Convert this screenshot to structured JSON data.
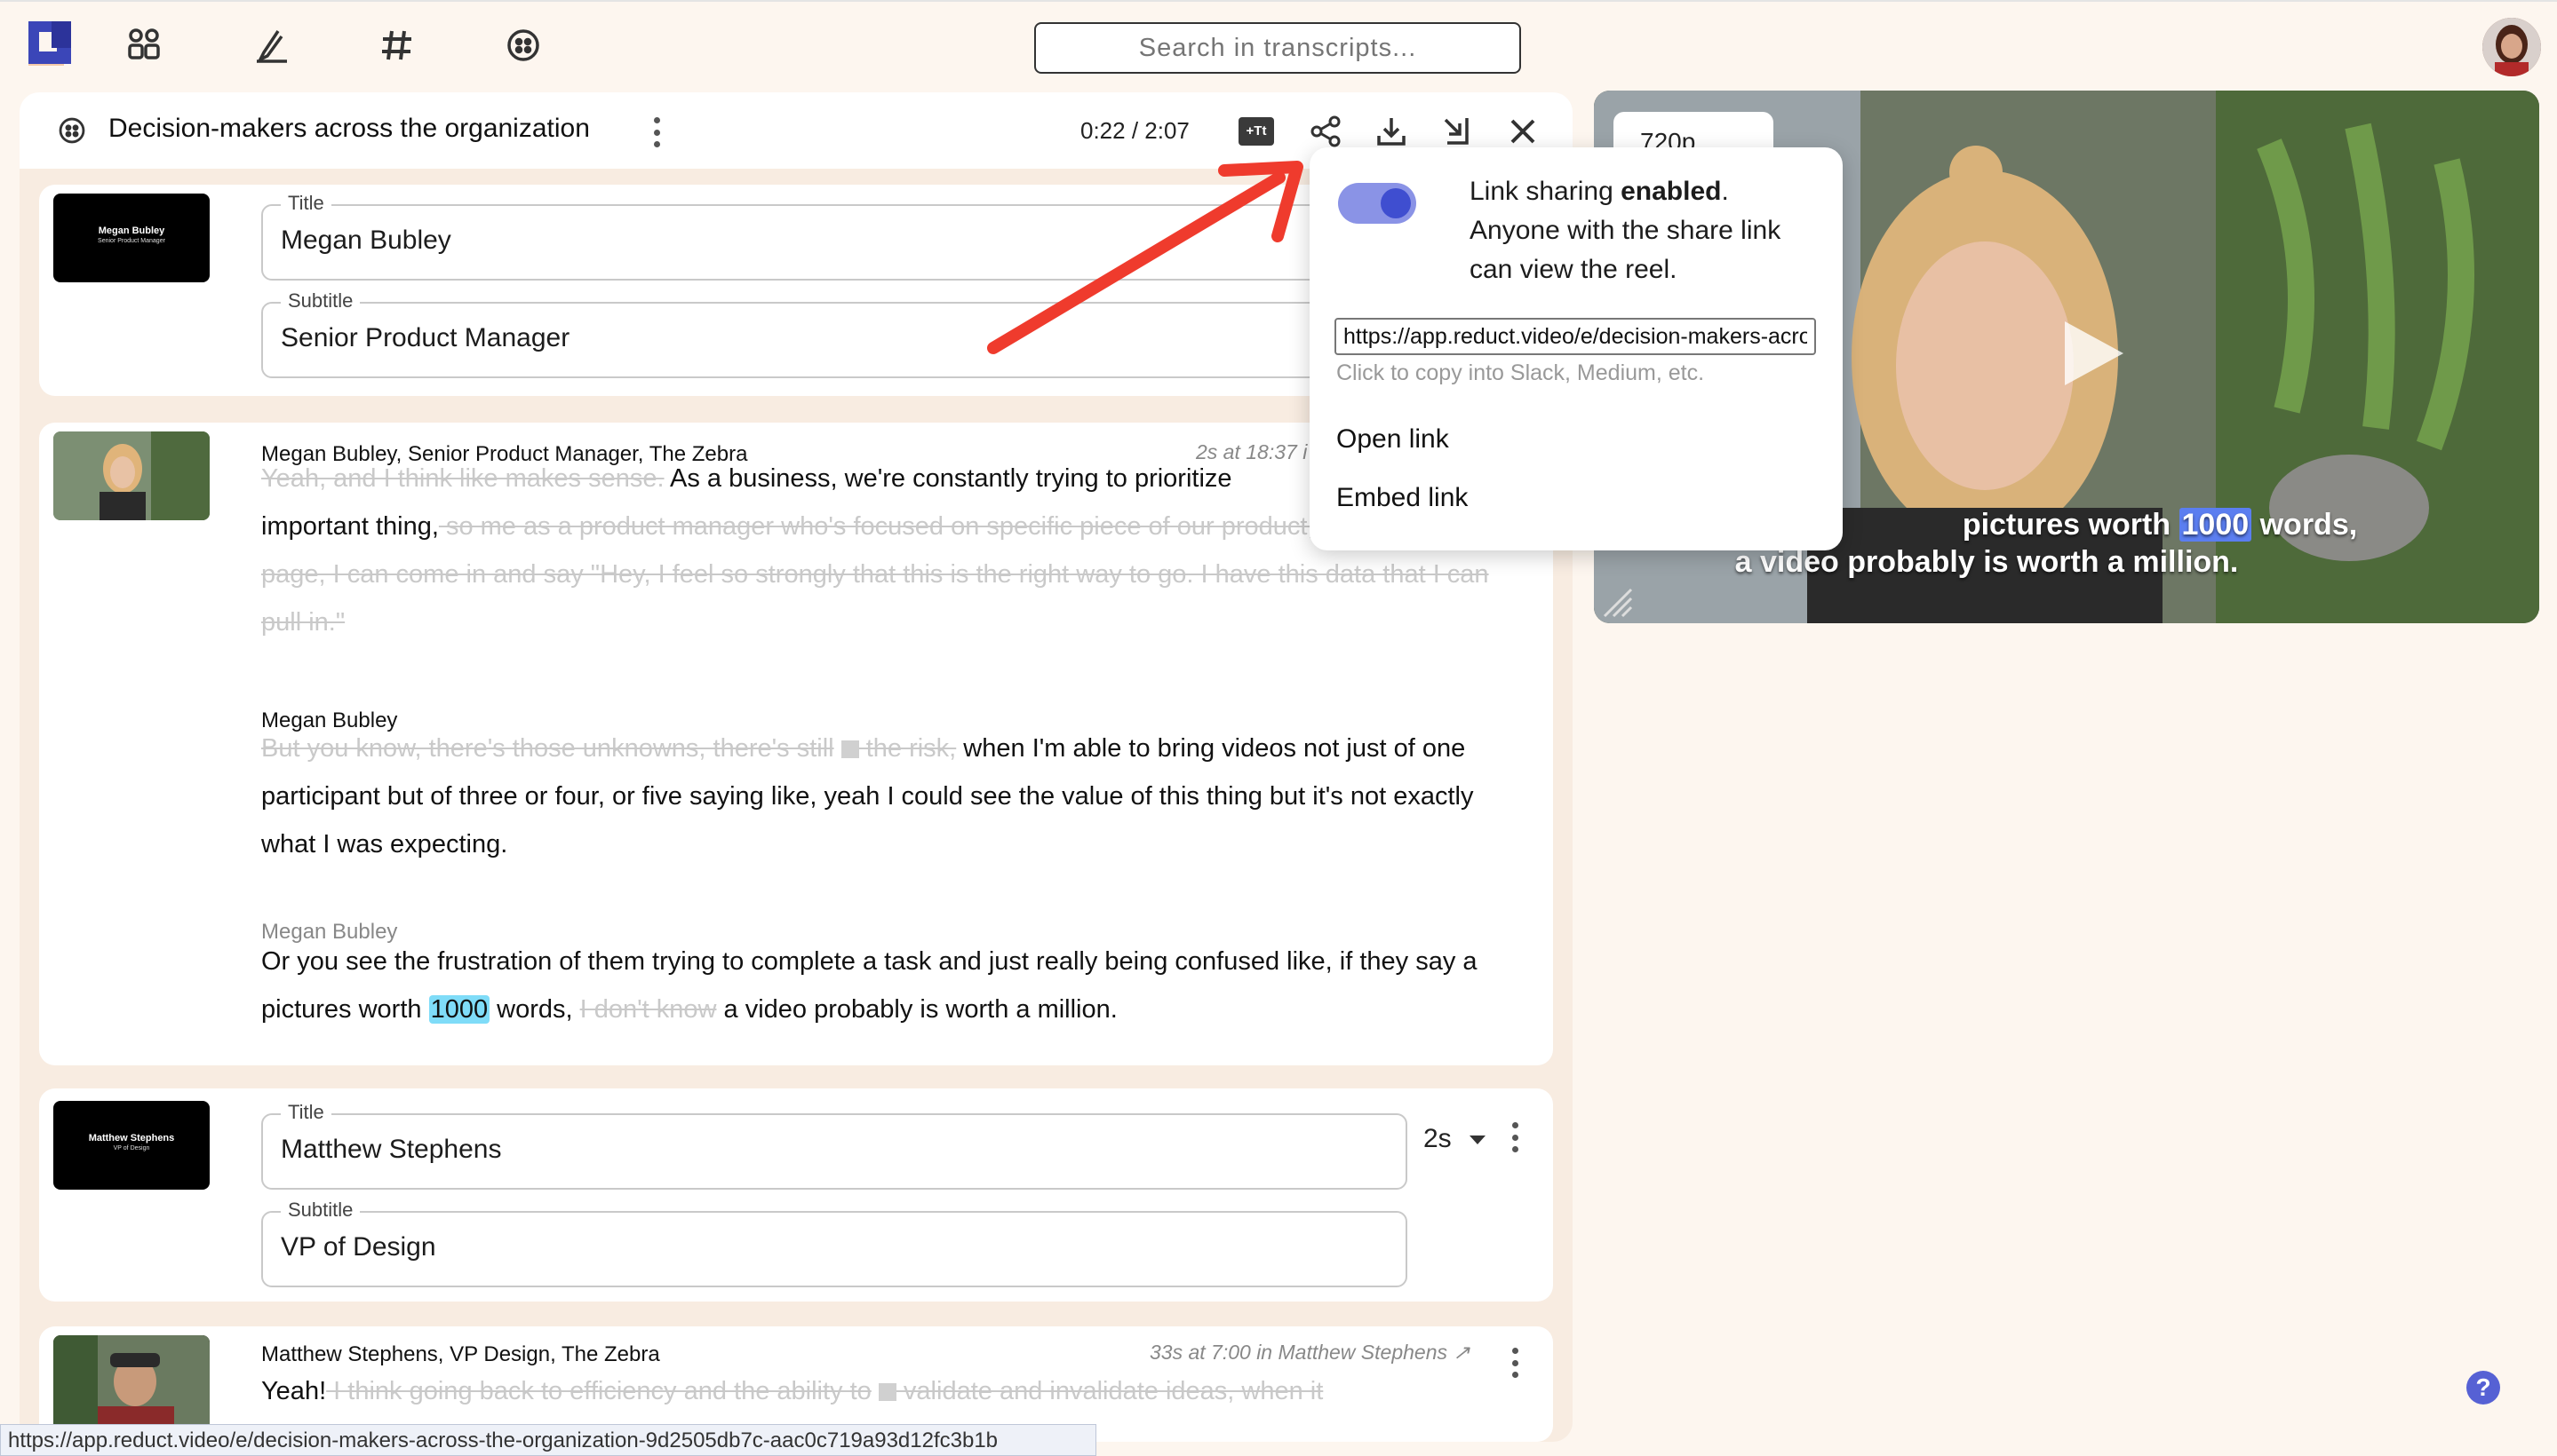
{
  "search": {
    "placeholder": "Search in transcripts..."
  },
  "reel": {
    "title": "Decision-makers across the organization",
    "timecode": "0:22 / 2:07",
    "captions_label": "+Tt"
  },
  "card1": {
    "thumb_name": "Megan Bubley",
    "thumb_sub": "Senior Product Manager",
    "title_label": "Title",
    "title_value": "Megan Bubley",
    "subtitle_label": "Subtitle",
    "subtitle_value": "Senior Product Manager"
  },
  "clip1": {
    "speaker": "Megan Bubley, Senior Product Manager, The Zebra",
    "meta": "2s at 18:37 i",
    "p1_strike1": "Yeah, and I think like makes sense.",
    "p1_text1": " As a business, we're constantly trying to prioritize",
    "p1_text2": "important thing,",
    "p1_strike2": " so me as a product manager who's focused on specific piece of our product, the auto results page, I can come in and say \"Hey, I feel so strongly that this is the right way to go. I have this data that I can pull in.\"",
    "speaker2": "Megan Bubley",
    "p2_strike1": "But you know, there's those unknowns, there's still",
    "p2_strike2": " the risk,",
    "p2_text": " when I'm able to bring videos not just of one participant but of three or four, or five saying like, yeah I could see the value of this thing but it's not exactly what I was expecting.",
    "speaker3": "Megan Bubley",
    "p3_text1": "Or you see the frustration of them trying to complete a task and just really being confused like, if they say a pictures worth ",
    "p3_hl": "1000",
    "p3_text2": " words, ",
    "p3_strike": "I don't know",
    "p3_text3": " a video probably is worth a million."
  },
  "card2": {
    "thumb_name": "Matthew Stephens",
    "thumb_sub": "VP of Design",
    "title_label": "Title",
    "title_value": "Matthew Stephens",
    "subtitle_label": "Subtitle",
    "subtitle_value": "VP of Design",
    "duration": "2s"
  },
  "clip2": {
    "speaker": "Matthew Stephens, VP Design, The Zebra",
    "meta": "33s at 7:00 in Matthew Stephens ↗",
    "text": "Yeah!",
    "strike": " I think going back to efficiency and the ability to",
    "strike2": " validate and invalidate ideas, when it"
  },
  "video": {
    "quality": "720p",
    "caption1_a": "pictures worth ",
    "caption1_hl": "1000",
    "caption1_b": " words,",
    "caption2": "a video probably is worth a million."
  },
  "share_popup": {
    "line1_a": "Link sharing ",
    "line1_b": "enabled",
    "line1_c": ".",
    "line2": "Anyone with the share link can view the reel.",
    "url": "https://app.reduct.video/e/decision-makers-across-the-organization-9d2505db7c-aac0c719a93d12fc3b1b",
    "hint": "Click to copy into Slack, Medium, etc.",
    "open_link": "Open link",
    "embed_link": "Embed link",
    "toggle_on": true
  },
  "statusbar": {
    "url": "https://app.reduct.video/e/decision-makers-across-the-organization-9d2505db7c-aac0c719a93d12fc3b1b"
  },
  "help": {
    "label": "?"
  }
}
